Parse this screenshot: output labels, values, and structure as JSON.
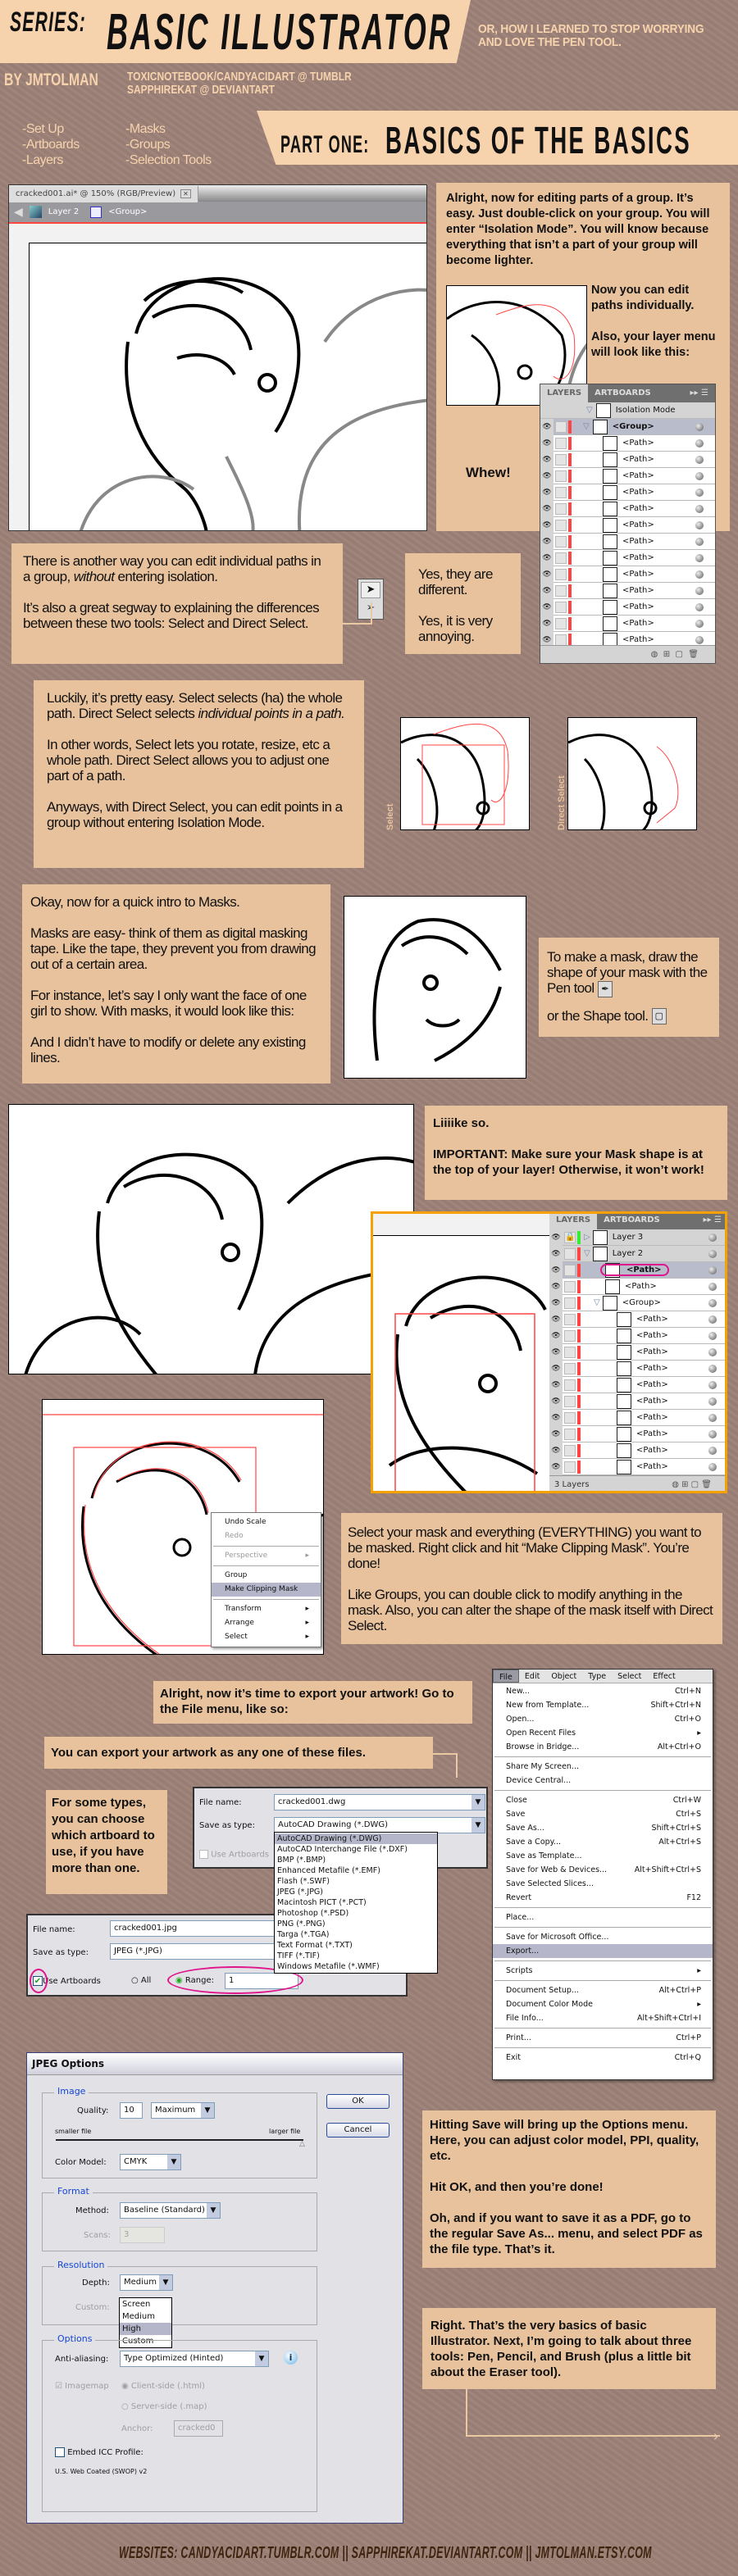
{
  "header": {
    "series_label": "SERIES:",
    "title": "BASIC ILLUSTRATOR",
    "subtitle": "OR, HOW I LEARNED TO STOP WORRYING AND LOVE THE PEN TOOL.",
    "byline": "BY JMTOLMAN",
    "handles": [
      "TOXICNOTEBOOK/CANDYACIDART @ TUMBLR",
      "SAPPHIREKAT @ DEVIANTART"
    ],
    "topics_left": [
      "-Set Up",
      "-Artboards",
      "-Layers"
    ],
    "topics_right": [
      "-Masks",
      "-Groups",
      "-Selection Tools"
    ],
    "part_label": "PART ONE:",
    "part_title": "BASICS OF THE BASICS"
  },
  "colors": {
    "background": "#9c8178",
    "box": "#e8c29c",
    "banner": "#f7d3ad",
    "accent_red": "#f44444",
    "highlight_magenta": "#e0158c",
    "frame_orange": "#f5a200"
  },
  "window1": {
    "tab_title": "cracked001.ai* @ 150% (RGB/Preview)",
    "breadcrumb_layer": "Layer 2",
    "breadcrumb_group": "<Group>"
  },
  "groups_box": {
    "intro": "Alright, now for editing parts of a group. It’s easy. Just double-click on your group. You will enter “Isolation Mode”. You will know because everything that isn’t a part of your group will become lighter.",
    "edit_paths": "Now you can edit paths individually.",
    "layer_menu": "Also, your layer menu will look like this:",
    "whew": "Whew!"
  },
  "layers1": {
    "tabs": [
      "LAYERS",
      "ARTBOARDS"
    ],
    "header_row": "Isolation Mode",
    "group_row": "<Group>",
    "paths": [
      "<Path>",
      "<Path>",
      "<Path>",
      "<Path>",
      "<Path>",
      "<Path>",
      "<Path>",
      "<Path>",
      "<Path>",
      "<Path>",
      "<Path>",
      "<Path>",
      "<Path>"
    ]
  },
  "selection_box": {
    "p1_pre": "There is another way you can edit individual paths in a group, ",
    "p1_em": "without",
    "p1_post": " entering isolation.",
    "p2": "It’s also a great segway to explaining the differences between these two tools: Select and Direct Select."
  },
  "yes_box": {
    "p1": "Yes, they are different.",
    "p2": "Yes, it is very annoying."
  },
  "luckily_box": {
    "p1_pre": "Luckily, it’s pretty easy. Select selects (ha) the whole path. Direct Select selects ",
    "p1_em": "individual points in a path.",
    "p2": "In other words, Select lets you rotate, resize, etc a whole path. Direct Select allows you to adjust one part of a path.",
    "p3": "Anyways, with Direct Select, you can edit points in a group without entering Isolation Mode."
  },
  "select_labels": {
    "select": "Select",
    "direct_select": "Direct Select"
  },
  "masks_box": {
    "p1": "Okay, now for a quick intro to Masks.",
    "p2": "Masks are easy- think of them as digital masking tape. Like the tape, they prevent you from drawing out of a certain area.",
    "p3": "For instance, let’s say I only want the face of one girl to show. With masks, it would look like this:",
    "p4": "And I didn’t have to modify or delete any existing lines."
  },
  "make_mask_box": {
    "p1": "To make a mask, draw the shape of your mask with the Pen tool",
    "p2": "or the Shape tool."
  },
  "likeso_box": {
    "p1": "Liiiike so.",
    "p2": "IMPORTANT: Make sure your Mask shape is at the top of your layer! Otherwise, it won’t work!"
  },
  "layers2": {
    "tabs": [
      "LAYERS",
      "ARTBOARDS"
    ],
    "rows": [
      {
        "label": "Layer 3",
        "kind": "layer"
      },
      {
        "label": "Layer 2",
        "kind": "layer"
      },
      {
        "label": "<Path>",
        "kind": "selected"
      },
      {
        "label": "<Path>",
        "kind": "item"
      },
      {
        "label": "<Group>",
        "kind": "group"
      },
      {
        "label": "<Path>",
        "kind": "sub"
      },
      {
        "label": "<Path>",
        "kind": "sub"
      },
      {
        "label": "<Path>",
        "kind": "sub"
      },
      {
        "label": "<Path>",
        "kind": "sub"
      },
      {
        "label": "<Path>",
        "kind": "sub"
      },
      {
        "label": "<Path>",
        "kind": "sub"
      },
      {
        "label": "<Path>",
        "kind": "sub"
      },
      {
        "label": "<Path>",
        "kind": "sub"
      },
      {
        "label": "<Path>",
        "kind": "sub"
      },
      {
        "label": "<Path>",
        "kind": "sub"
      }
    ],
    "footer": "3 Layers"
  },
  "context_menu": {
    "items": [
      {
        "label": "Undo Scale"
      },
      {
        "label": "Redo",
        "disabled": true
      },
      {
        "sep": true
      },
      {
        "label": "Perspective",
        "disabled": true,
        "submenu": true
      },
      {
        "sep": true
      },
      {
        "label": "Group"
      },
      {
        "label": "Make Clipping Mask",
        "highlighted": true
      },
      {
        "sep": true
      },
      {
        "label": "Transform",
        "submenu": true
      },
      {
        "label": "Arrange",
        "submenu": true
      },
      {
        "label": "Select",
        "submenu": true
      }
    ]
  },
  "clip_box": {
    "p1": "Select your mask and everything (EVERYTHING) you want to be masked. Right click and hit “Make Clipping Mask”. You’re done!",
    "p2": "Like Groups, you can double click to modify anything in the mask. Also, you can alter the shape of the mask itself with Direct Select."
  },
  "export_box": {
    "text": "Alright, now it’s time to export your artwork! Go to the File menu, like so:"
  },
  "export_types_box": {
    "text": "You can export your artwork as any one of these files."
  },
  "artboard_box": {
    "text": "For some types, you can choose which artboard to use, if you have more than one."
  },
  "file_menu": {
    "menubar": [
      "File",
      "Edit",
      "Object",
      "Type",
      "Select",
      "Effect"
    ],
    "items": [
      {
        "label": "New...",
        "shortcut": "Ctrl+N"
      },
      {
        "label": "New from Template...",
        "shortcut": "Shift+Ctrl+N"
      },
      {
        "label": "Open...",
        "shortcut": "Ctrl+O"
      },
      {
        "label": "Open Recent Files",
        "submenu": true
      },
      {
        "label": "Browse in Bridge...",
        "shortcut": "Alt+Ctrl+O"
      },
      {
        "sep": true
      },
      {
        "label": "Share My Screen..."
      },
      {
        "label": "Device Central..."
      },
      {
        "sep": true
      },
      {
        "label": "Close",
        "shortcut": "Ctrl+W"
      },
      {
        "label": "Save",
        "shortcut": "Ctrl+S"
      },
      {
        "label": "Save As...",
        "shortcut": "Shift+Ctrl+S"
      },
      {
        "label": "Save a Copy...",
        "shortcut": "Alt+Ctrl+S"
      },
      {
        "label": "Save as Template..."
      },
      {
        "label": "Save for Web & Devices...",
        "shortcut": "Alt+Shift+Ctrl+S"
      },
      {
        "label": "Save Selected Slices..."
      },
      {
        "label": "Revert",
        "shortcut": "F12"
      },
      {
        "sep": true
      },
      {
        "label": "Place..."
      },
      {
        "sep": true
      },
      {
        "label": "Save for Microsoft Office..."
      },
      {
        "label": "Export...",
        "highlighted": true
      },
      {
        "sep": true
      },
      {
        "label": "Scripts",
        "submenu": true
      },
      {
        "sep": true
      },
      {
        "label": "Document Setup...",
        "shortcut": "Alt+Ctrl+P"
      },
      {
        "label": "Document Color Mode",
        "submenu": true
      },
      {
        "label": "File Info...",
        "shortcut": "Alt+Shift+Ctrl+I"
      },
      {
        "sep": true
      },
      {
        "label": "Print...",
        "shortcut": "Ctrl+P"
      },
      {
        "sep": true
      },
      {
        "label": "Exit",
        "shortcut": "Ctrl+Q"
      }
    ]
  },
  "export_dialog1": {
    "file_name_label": "File name:",
    "file_name": "cracked001.dwg",
    "type_label": "Save as type:",
    "type_value": "AutoCAD Drawing (*.DWG)",
    "use_artboards": "Use Artboards",
    "type_options": [
      "AutoCAD Drawing (*.DWG)",
      "AutoCAD Interchange File (*.DXF)",
      "BMP (*.BMP)",
      "Enhanced Metafile (*.EMF)",
      "Flash (*.SWF)",
      "JPEG (*.JPG)",
      "Macintosh PICT (*.PCT)",
      "Photoshop (*.PSD)",
      "PNG (*.PNG)",
      "Targa (*.TGA)",
      "Text Format (*.TXT)",
      "TIFF (*.TIF)",
      "Windows Metafile (*.WMF)"
    ]
  },
  "export_dialog2": {
    "file_name_label": "File name:",
    "file_name": "cracked001.jpg",
    "type_label": "Save as type:",
    "type_value": "JPEG (*.JPG)",
    "use_artboards": "Use Artboards",
    "use_artboards_checked": true,
    "all_label": "All",
    "range_label": "Range:",
    "range_value": "1"
  },
  "jpeg_options": {
    "title": "JPEG Options",
    "ok": "OK",
    "cancel": "Cancel",
    "image_group": "Image",
    "quality_label": "Quality:",
    "quality_value": "10",
    "quality_preset": "Maximum",
    "smaller_file": "smaller file",
    "larger_file": "larger file",
    "quality_slider_max": 10,
    "color_model_label": "Color Model:",
    "color_model": "CMYK",
    "format_group": "Format",
    "method_label": "Method:",
    "method": "Baseline (Standard)",
    "scans_label": "Scans:",
    "scans": "3",
    "resolution_group": "Resolution",
    "depth_label": "Depth:",
    "depth": "Medium",
    "custom_label": "Custom:",
    "depth_options": [
      "Screen",
      "Medium",
      "High",
      "Custom"
    ],
    "depth_hover": "High",
    "options_group": "Options",
    "antialias_label": "Anti-aliasing:",
    "antialias": "Type Optimized (Hinted)",
    "imagemap": "Imagemap",
    "client_side": "Client-side (.html)",
    "server_side": "Server-side (.map)",
    "anchor_label": "Anchor:",
    "anchor": "cracked0",
    "embed_icc": "Embed ICC Profile:",
    "icc_profile": "U.S. Web Coated (SWOP) v2"
  },
  "save_box": {
    "p1": "Hitting Save will bring up the Options menu. Here, you can adjust color model, PPI, quality, etc.",
    "p2": "Hit OK, and then you’re done!",
    "p3": "Oh, and if you want to save it as a PDF, go to the regular Save As... menu, and select PDF as the file type. That’s it."
  },
  "closing_box": {
    "text": "Right. That’s the very basics of basic Illustrator. Next, I’m going to talk about three tools: Pen, Pencil, and Brush (plus a little bit about the Eraser tool)."
  },
  "footer": {
    "text": "WEBSITES: CANDYACIDART.TUMBLR.COM || SAPPHIREKAT.DEVIANTART.COM || JMTOLMAN.ETSY.COM"
  }
}
